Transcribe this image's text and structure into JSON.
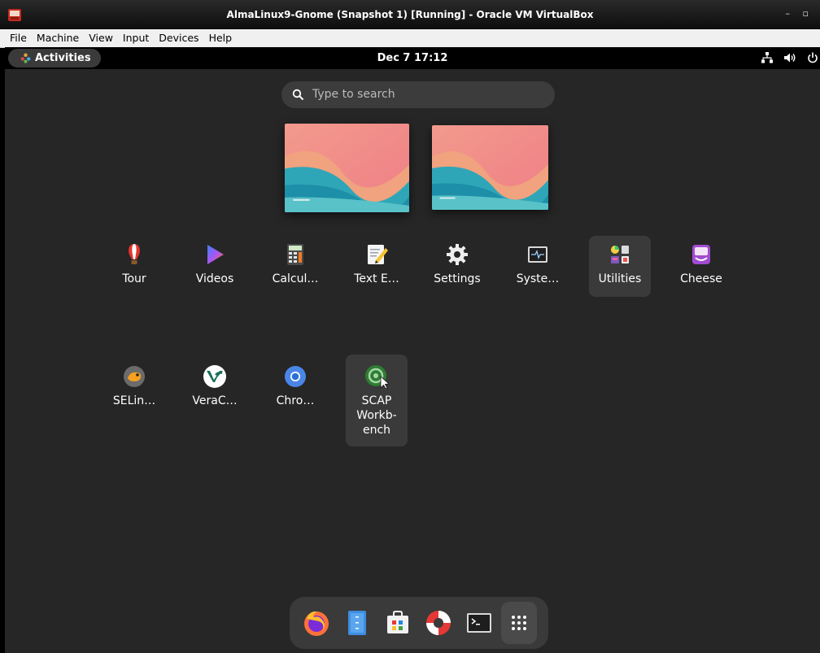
{
  "window": {
    "title": "AlmaLinux9-Gnome (Snapshot 1) [Running] - Oracle VM VirtualBox",
    "controls": "– ▫"
  },
  "menubar": [
    "File",
    "Machine",
    "View",
    "Input",
    "Devices",
    "Help"
  ],
  "topbar": {
    "activities": "Activities",
    "clock": "Dec 7  17:12",
    "tray_icons": [
      "network-icon",
      "volume-icon",
      "power-icon"
    ]
  },
  "search": {
    "placeholder": "Type to search"
  },
  "apps": [
    {
      "label": "Tour",
      "icon": "tour-icon"
    },
    {
      "label": "Videos",
      "icon": "videos-icon"
    },
    {
      "label": "Calcul…",
      "icon": "calculator-icon"
    },
    {
      "label": "Text E…",
      "icon": "text-editor-icon"
    },
    {
      "label": "Settings",
      "icon": "settings-icon"
    },
    {
      "label": "Syste…",
      "icon": "system-monitor-icon"
    },
    {
      "label": "Utilities",
      "icon": "utilities-folder-icon"
    },
    {
      "label": "Cheese",
      "icon": "cheese-icon"
    },
    {
      "label": "SELin…",
      "icon": "selinux-icon"
    },
    {
      "label": "VeraC…",
      "icon": "veracrypt-icon"
    },
    {
      "label": "Chro…",
      "icon": "chromium-icon"
    },
    {
      "label": "SCAP\nWorkb-\nench",
      "icon": "scap-workbench-icon"
    }
  ],
  "dock": [
    "firefox-icon",
    "files-icon",
    "software-icon",
    "help-icon",
    "terminal-icon",
    "show-apps-icon"
  ]
}
